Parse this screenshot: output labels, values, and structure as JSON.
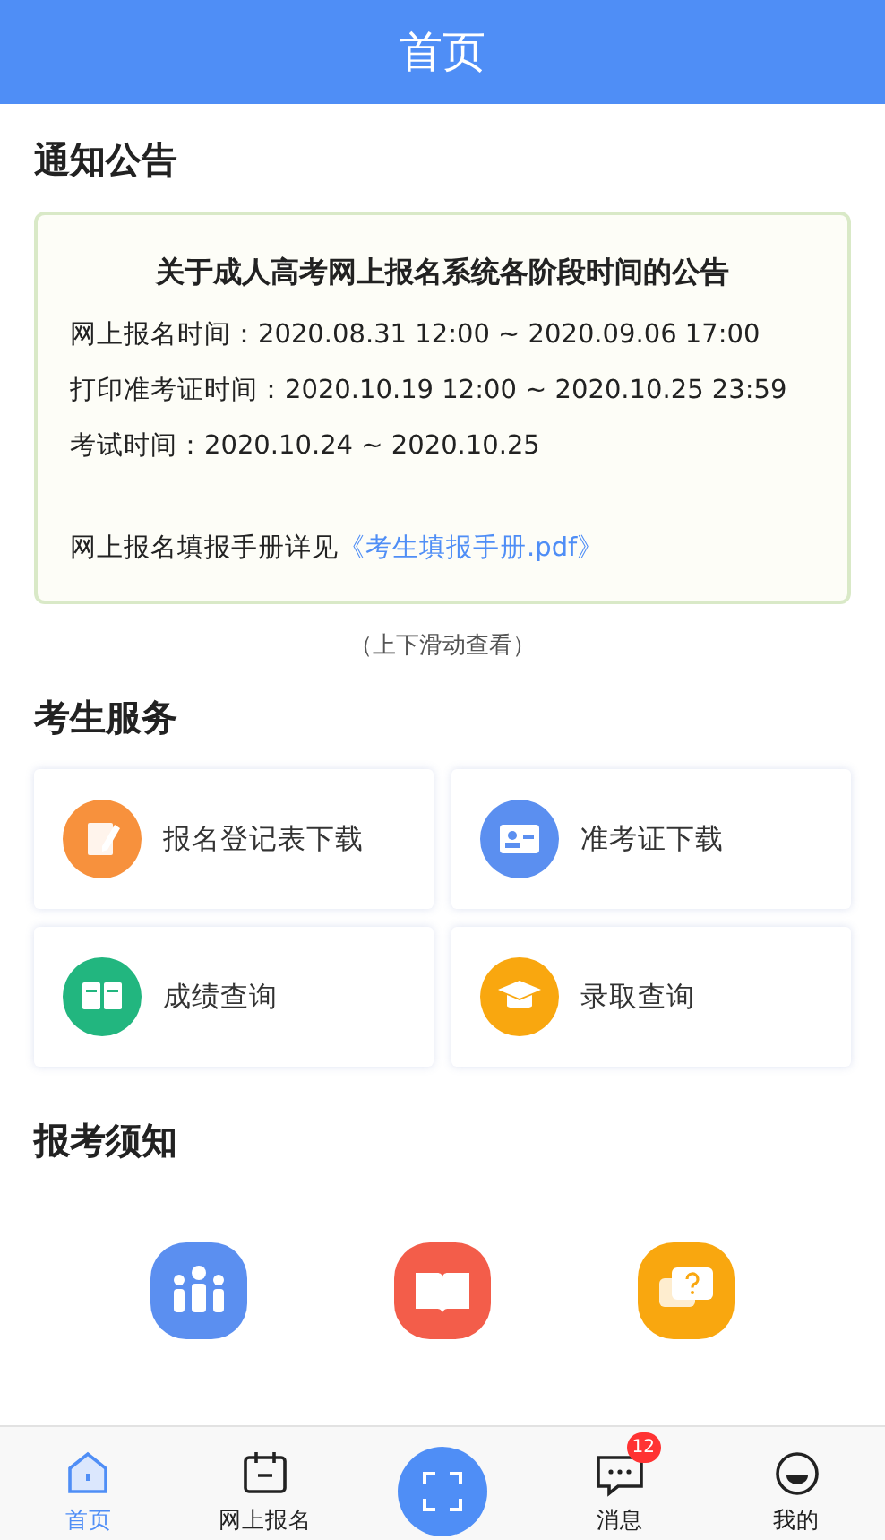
{
  "header": {
    "title": "首页"
  },
  "notice_section": {
    "title": "通知公告",
    "card": {
      "title": "关于成人高考网上报名系统各阶段时间的公告",
      "lines": [
        "网上报名时间：2020.08.31 12:00 ~ 2020.09.06 17:00",
        "打印准考证时间：2020.10.19 12:00 ~ 2020.10.25 23:59",
        "考试时间：2020.10.24 ~ 2020.10.25"
      ],
      "manual": {
        "text": "网上报名填报手册详见",
        "link": "《考生填报手册.pdf》"
      }
    },
    "hint": "（上下滑动查看）"
  },
  "services_section": {
    "title": "考生服务",
    "items": [
      {
        "label": "报名登记表下载",
        "kind": "form",
        "color": "#f7913d"
      },
      {
        "label": "准考证下载",
        "kind": "card",
        "color": "#5b8ff0"
      },
      {
        "label": "成绩查询",
        "kind": "book",
        "color": "#22b67f"
      },
      {
        "label": "录取查询",
        "kind": "cap",
        "color": "#f9a70f"
      }
    ]
  },
  "guide_section": {
    "title": "报考须知",
    "items": [
      {
        "kind": "people",
        "color": "#5b8ff0"
      },
      {
        "kind": "book",
        "color": "#f35d4a"
      },
      {
        "kind": "question",
        "color": "#f9a70f"
      }
    ]
  },
  "tab_bar": [
    {
      "label": "首页",
      "kind": "home",
      "selected": true
    },
    {
      "label": "网上报名",
      "kind": "calendar",
      "selected": false
    },
    {
      "kind": "scan",
      "selected": false
    },
    {
      "label": "消息",
      "kind": "message",
      "selected": false,
      "badge": "12"
    },
    {
      "label": "我的",
      "kind": "face",
      "selected": false
    }
  ]
}
